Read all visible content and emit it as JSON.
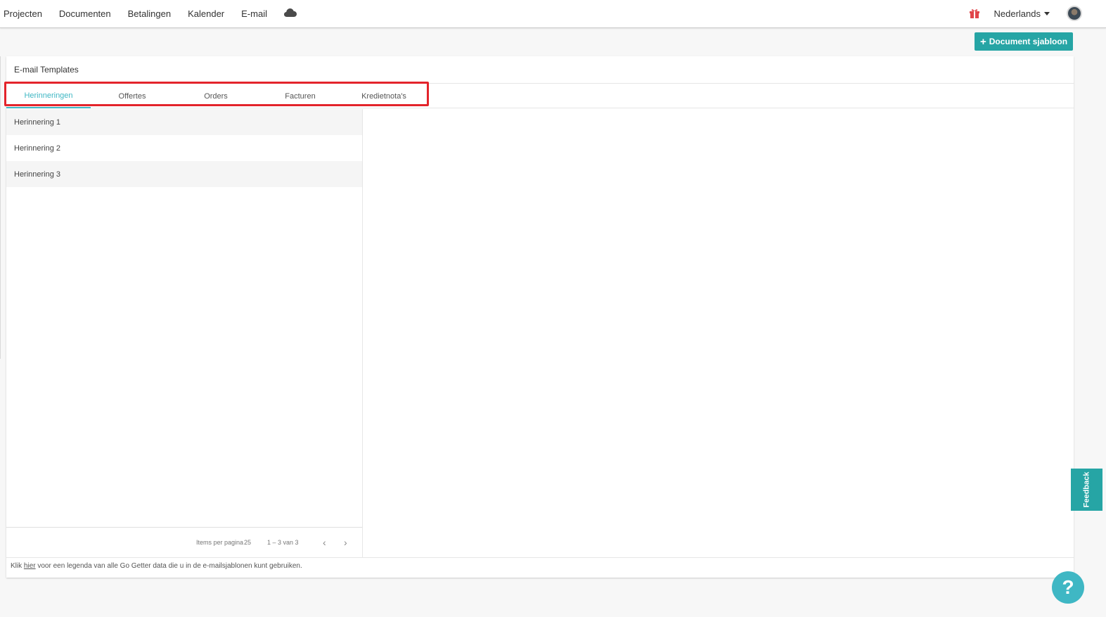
{
  "nav": {
    "items": [
      "Projecten",
      "Documenten",
      "Betalingen",
      "Kalender",
      "E-mail"
    ],
    "language": "Nederlands"
  },
  "actions": {
    "add_template": "Document sjabloon"
  },
  "card": {
    "title": "E-mail Templates",
    "tabs": [
      "Herinneringen",
      "Offertes",
      "Orders",
      "Facturen",
      "Kredietnota's"
    ],
    "active_tab": "Herinneringen",
    "list": [
      "Herinnering 1",
      "Herinnering 2",
      "Herinnering 3"
    ],
    "pager": {
      "items_per_page_label": "Items per pagina",
      "items_per_page": "25",
      "range": "1 – 3 van 3"
    },
    "footer": {
      "prefix": "Klik ",
      "link": "hier",
      "suffix": " voor een legenda van alle Go Getter data die u in de e-mailsjablonen kunt gebruiken."
    }
  },
  "feedback_label": "Feedback",
  "help_label": "?",
  "colors": {
    "accent": "#26a5a5",
    "tab_active": "#3fb7c4",
    "highlight": "#e3242b",
    "gift": "#e0454a"
  },
  "icons": {
    "cloud": "cloud-icon",
    "gift": "gift-icon",
    "caret": "caret-down-icon",
    "prev": "chevron-left-icon",
    "next": "chevron-right-icon",
    "plus": "plus-icon"
  }
}
